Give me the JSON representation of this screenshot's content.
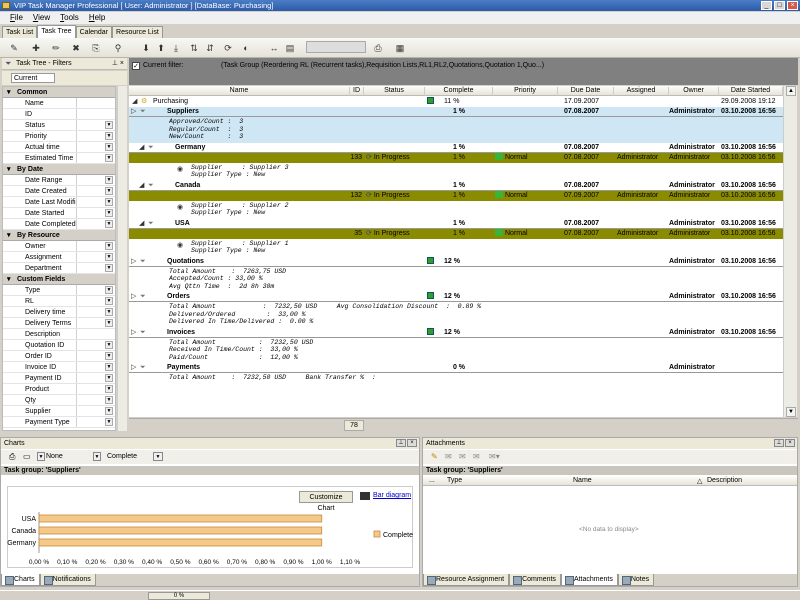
{
  "window": {
    "title": "VIP Task Manager Professional [ User: Administrator ] [DataBase: Purchasing]"
  },
  "menu": [
    "File",
    "View",
    "Tools",
    "Help"
  ],
  "tabs": [
    "Task List",
    "Task Tree",
    "Calendar",
    "Resource List"
  ],
  "active_tab": "Task Tree",
  "filter_panel": {
    "title": "Task Tree - Filters",
    "current": "Current",
    "sections": [
      {
        "name": "Common",
        "items": [
          {
            "label": "Name",
            "dd": false
          },
          {
            "label": "ID",
            "dd": false
          },
          {
            "label": "Status",
            "dd": true
          },
          {
            "label": "Priority",
            "dd": true
          },
          {
            "label": "Actual time",
            "dd": true
          },
          {
            "label": "Estimated Time",
            "dd": true
          }
        ]
      },
      {
        "name": "By Date",
        "items": [
          {
            "label": "Date Range",
            "dd": true
          },
          {
            "label": "Date Created",
            "dd": true
          },
          {
            "label": "Date Last Modifie",
            "dd": true
          },
          {
            "label": "Date Started",
            "dd": true
          },
          {
            "label": "Date Completed",
            "dd": true
          }
        ]
      },
      {
        "name": "By Resource",
        "items": [
          {
            "label": "Owner",
            "dd": true
          },
          {
            "label": "Assignment",
            "dd": true
          },
          {
            "label": "Department",
            "dd": true
          }
        ]
      },
      {
        "name": "Custom Fields",
        "items": [
          {
            "label": "Type",
            "dd": true
          },
          {
            "label": "RL",
            "dd": true
          },
          {
            "label": "Delivery time",
            "dd": true
          },
          {
            "label": "Delivery Terms",
            "dd": true
          },
          {
            "label": "Description",
            "dd": false
          },
          {
            "label": "Quotation ID",
            "dd": true
          },
          {
            "label": "Order ID",
            "dd": true
          },
          {
            "label": "Invoice ID",
            "dd": true
          },
          {
            "label": "Payment ID",
            "dd": true
          },
          {
            "label": "Product",
            "dd": true
          },
          {
            "label": "Qty",
            "dd": true
          },
          {
            "label": "Supplier",
            "dd": true
          },
          {
            "label": "Payment Type",
            "dd": true
          }
        ]
      }
    ]
  },
  "current_filter": {
    "label": "Current filter:",
    "text": "(Task Group  (Reordering RL (Recurrent tasks),Requisition Lists,RL1,RL2,Quotations,Quotation 1,Quo...)"
  },
  "grid": {
    "columns": [
      "Name",
      "ID",
      "Status",
      "Complete",
      "Priority",
      "Due Date",
      "Assigned",
      "Owner",
      "Date Started"
    ],
    "record_count": "78",
    "rows": [
      {
        "kind": "root",
        "name": "Purchasing",
        "complete": "11 %",
        "due": "17.09.2007",
        "started": "29.09.2008 19:12"
      },
      {
        "kind": "group",
        "sel": true,
        "name": "Suppliers",
        "complete": "1 %",
        "due": "07.08.2007",
        "owner": "Administrator",
        "started": "03.10.2008 16:56"
      },
      {
        "kind": "note",
        "sel": true,
        "lines": [
          "Approved/Count :  3",
          "Regular/Count  :  3",
          "New/Count      :  3"
        ]
      },
      {
        "kind": "group",
        "indent": 1,
        "name": "Germany",
        "complete": "1 %",
        "due": "07.08.2007",
        "owner": "Administrator",
        "started": "03.10.2008 16:56"
      },
      {
        "kind": "task",
        "id": "133",
        "status": "In Progress",
        "complete": "1 %",
        "priority": "Normal",
        "due": "07.08.2007",
        "assigned": "Administrator",
        "owner": "Administrator",
        "started": "03.10.2008 16:56"
      },
      {
        "kind": "tnote",
        "lines": [
          "Supplier     : Supplier 3",
          "Supplier Type : New"
        ]
      },
      {
        "kind": "group",
        "indent": 1,
        "name": "Canada",
        "complete": "1 %",
        "due": "07.08.2007",
        "owner": "Administrator",
        "started": "03.10.2008 16:56"
      },
      {
        "kind": "task",
        "id": "132",
        "status": "In Progress",
        "complete": "1 %",
        "priority": "Normal",
        "due": "07.09.2007",
        "assigned": "Administrator",
        "owner": "Administrator",
        "started": "03.10.2008 16:56"
      },
      {
        "kind": "tnote",
        "lines": [
          "Supplier     : Supplier 2",
          "Supplier Type : New"
        ]
      },
      {
        "kind": "group",
        "indent": 1,
        "name": "USA",
        "complete": "1 %",
        "due": "07.08.2007",
        "owner": "Administrator",
        "started": "03.10.2008 16:56"
      },
      {
        "kind": "task",
        "id": "35",
        "status": "In Progress",
        "complete": "1 %",
        "priority": "Normal",
        "due": "07.08.2007",
        "assigned": "Administrator",
        "owner": "Administrator",
        "started": "03.10.2008 16:56"
      },
      {
        "kind": "tnote",
        "lines": [
          "Supplier     : Supplier 1",
          "Supplier Type : New"
        ]
      },
      {
        "kind": "group",
        "name": "Quotations",
        "complete": "12 %",
        "owner": "Administrator",
        "started": "03.10.2008 16:56"
      },
      {
        "kind": "note",
        "lines": [
          "Total Amount    :  7263,75 USD",
          "Accepted/Count : 33,00 %",
          "Avg Qttn Time  :  2d 8h 30m"
        ]
      },
      {
        "kind": "group",
        "name": "Orders",
        "complete": "12 %",
        "owner": "Administrator",
        "started": "03.10.2008 16:56"
      },
      {
        "kind": "note",
        "lines": [
          "Total Amount            :  7232,50 USD     Avg Consolidation Discount  :  0.89 %",
          "Delivered/Ordered        :  33,00 %",
          "Delivered In Time/Delivered :  0.00 %"
        ]
      },
      {
        "kind": "group",
        "name": "Invoices",
        "complete": "12 %",
        "owner": "Administrator",
        "started": "03.10.2008 16:56"
      },
      {
        "kind": "note",
        "lines": [
          "Total Amount           :  7232,50 USD",
          "Received In Time/Count :  33,00 %",
          "Paid/Count             :  12,00 %"
        ]
      },
      {
        "kind": "group",
        "name": "Payments",
        "complete": "0 %",
        "owner": "Administrator",
        "started": ""
      },
      {
        "kind": "note",
        "lines": [
          "Total Amount    :  7232,50 USD     Bank Transfer %  :"
        ]
      }
    ]
  },
  "charts": {
    "title": "Charts",
    "combo1": "None",
    "combo2": "Complete",
    "group_title": "Task group: 'Suppliers'",
    "customize_label": "Customize Chart",
    "bar_diagram_label": "Bar diagram",
    "tabs": [
      "Charts",
      "Notifications"
    ]
  },
  "chart_data": {
    "type": "bar",
    "orientation": "horizontal",
    "categories": [
      "USA",
      "Canada",
      "Germany"
    ],
    "series": [
      {
        "name": "Complete",
        "values": [
          1.0,
          1.0,
          1.0
        ]
      }
    ],
    "xlim": [
      0,
      1.1
    ],
    "xticks": [
      "0,00 %",
      "0,10 %",
      "0,20 %",
      "0,30 %",
      "0,40 %",
      "0,50 %",
      "0,60 %",
      "0,70 %",
      "0,80 %",
      "0,90 %",
      "1,00 %",
      "1,10 %"
    ],
    "legend": "right",
    "bar_color": "#f5c98a"
  },
  "attachments": {
    "title": "Attachments",
    "group_title": "Task group: 'Suppliers'",
    "columns": [
      "...",
      "Type",
      "Name",
      "Description"
    ],
    "empty": "<No data to display>",
    "tabs": [
      "Resource Assignment",
      "Comments",
      "Attachments",
      "Notes"
    ],
    "active_tab": "Attachments"
  },
  "status": {
    "progress": "0 %"
  }
}
